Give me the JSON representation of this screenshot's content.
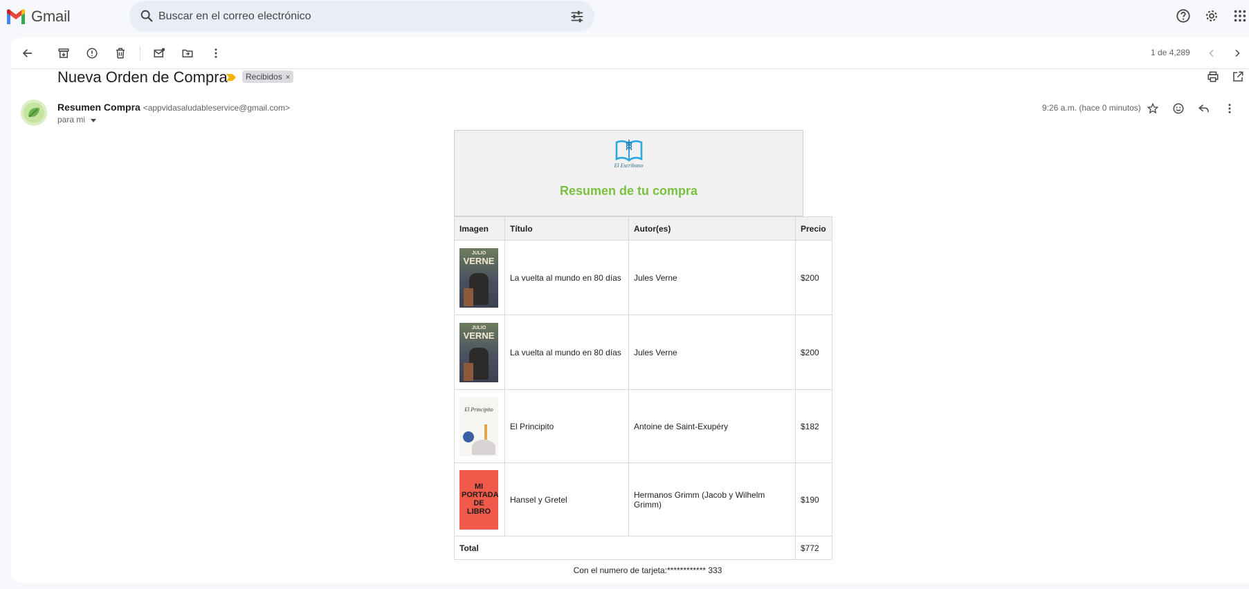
{
  "app": {
    "name": "Gmail"
  },
  "search": {
    "placeholder": "Buscar en el correo electrónico"
  },
  "toolbar": {
    "pager": "1 de 4,289"
  },
  "email": {
    "subject": "Nueva Orden de Compra",
    "label_chip": "Recibidos",
    "sender_name": "Resumen Compra",
    "sender_email": "<appvidasaludableservice@gmail.com>",
    "to": "para mi",
    "time": "9:26 a.m. (hace 0 minutos)"
  },
  "body": {
    "brand_name": "El Escribano",
    "heading": "Resumen de tu compra",
    "columns": [
      "Imagen",
      "Título",
      "Autor(es)",
      "Precio"
    ],
    "items": [
      {
        "title": "La vuelta al mundo en 80 días",
        "author": "Jules Verne",
        "price": "$200",
        "cover": "verne"
      },
      {
        "title": "La vuelta al mundo en 80 días",
        "author": "Jules Verne",
        "price": "$200",
        "cover": "verne"
      },
      {
        "title": "El Principito",
        "author": "Antoine de Saint-Exupéry",
        "price": "$182",
        "cover": "principito"
      },
      {
        "title": "Hansel y Gretel",
        "author": "Hermanos Grimm (Jacob y Wilhelm Grimm)",
        "price": "$190",
        "cover": "portada"
      }
    ],
    "total_label": "Total",
    "total_value": "$772",
    "card_line": "Con el numero de tarjeta:************ 333"
  },
  "cover_text": {
    "verne_top": "JULIO",
    "verne_main": "VERNE",
    "principito": "El Principito",
    "portada": "MI PORTADA DE LIBRO"
  },
  "colors": {
    "accent_green": "#7ac142",
    "brand_blue": "#29a8e0",
    "search_bg": "#e9eef6"
  }
}
